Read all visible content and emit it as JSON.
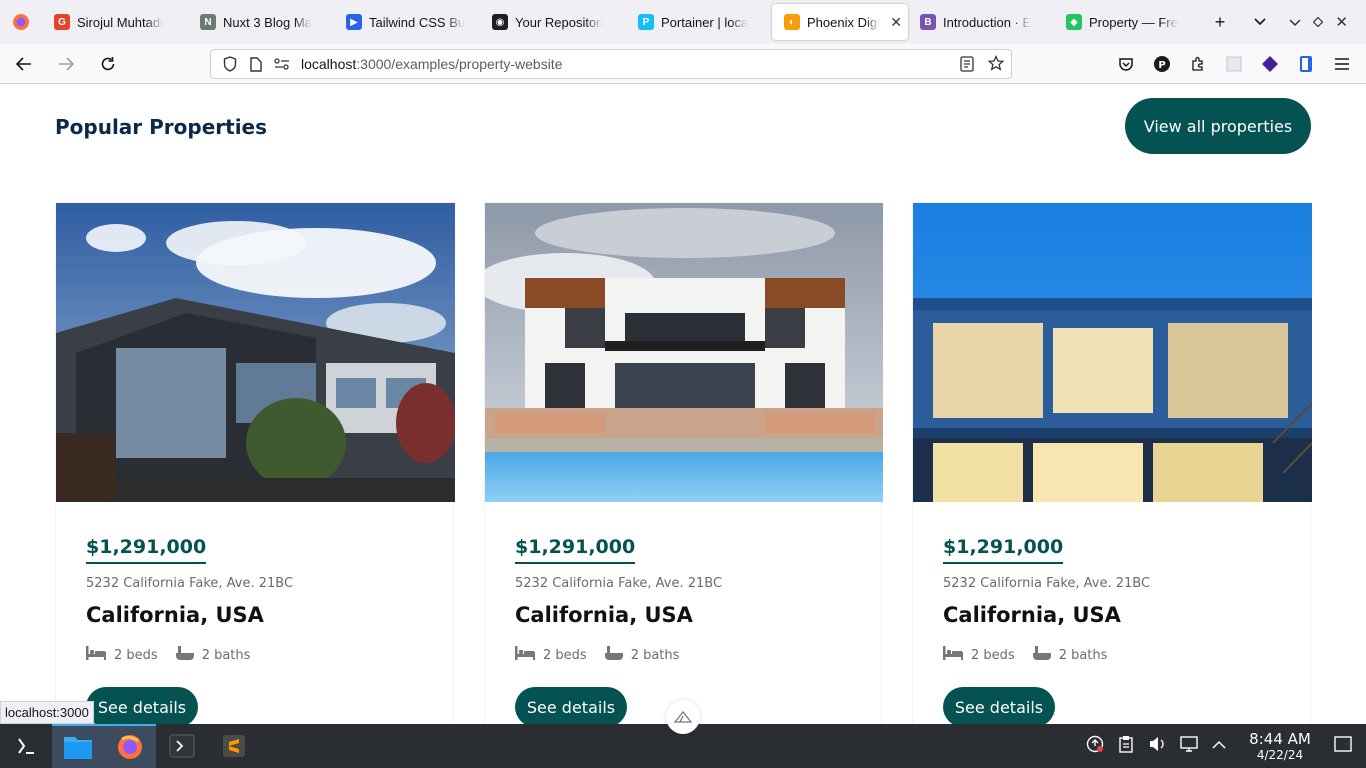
{
  "browser": {
    "tabs": [
      {
        "label": "Sirojul Muhtadi",
        "color": "#e24329",
        "glyph": "G"
      },
      {
        "label": "Nuxt 3 Blog Ma",
        "color": "#6b7b74",
        "glyph": "N"
      },
      {
        "label": "Tailwind CSS Bu",
        "color": "#2563eb",
        "glyph": "▶"
      },
      {
        "label": "Your Repositori",
        "color": "#1b1f23",
        "glyph": "◉"
      },
      {
        "label": "Portainer | loca",
        "color": "#13bef9",
        "glyph": "P"
      },
      {
        "label": "Phoenix Digi",
        "color": "#f59e0b",
        "glyph": "◐",
        "active": true
      },
      {
        "label": "Introduction · E",
        "color": "#7952b3",
        "glyph": "B"
      },
      {
        "label": "Property — Fre",
        "color": "#22c55e",
        "glyph": "◆"
      }
    ],
    "url_host": "localhost",
    "url_path": ":3000/examples/property-website"
  },
  "page": {
    "section_title": "Popular Properties",
    "view_all_label": "View all properties",
    "cards": [
      {
        "price": "$1,291,000",
        "address": "5232 California Fake, Ave. 21BC",
        "city": "California, USA",
        "beds": "2 beds",
        "baths": "2 baths",
        "button": "See details"
      },
      {
        "price": "$1,291,000",
        "address": "5232 California Fake, Ave. 21BC",
        "city": "California, USA",
        "beds": "2 beds",
        "baths": "2 baths",
        "button": "See details"
      },
      {
        "price": "$1,291,000",
        "address": "5232 California Fake, Ave. 21BC",
        "city": "California, USA",
        "beds": "2 beds",
        "baths": "2 baths",
        "button": "See details"
      }
    ],
    "status_tooltip": "localhost:3000"
  },
  "taskbar": {
    "time": "8:44 AM",
    "date": "4/22/24"
  },
  "colors": {
    "accent": "#045252",
    "title": "#0b2a4a"
  }
}
